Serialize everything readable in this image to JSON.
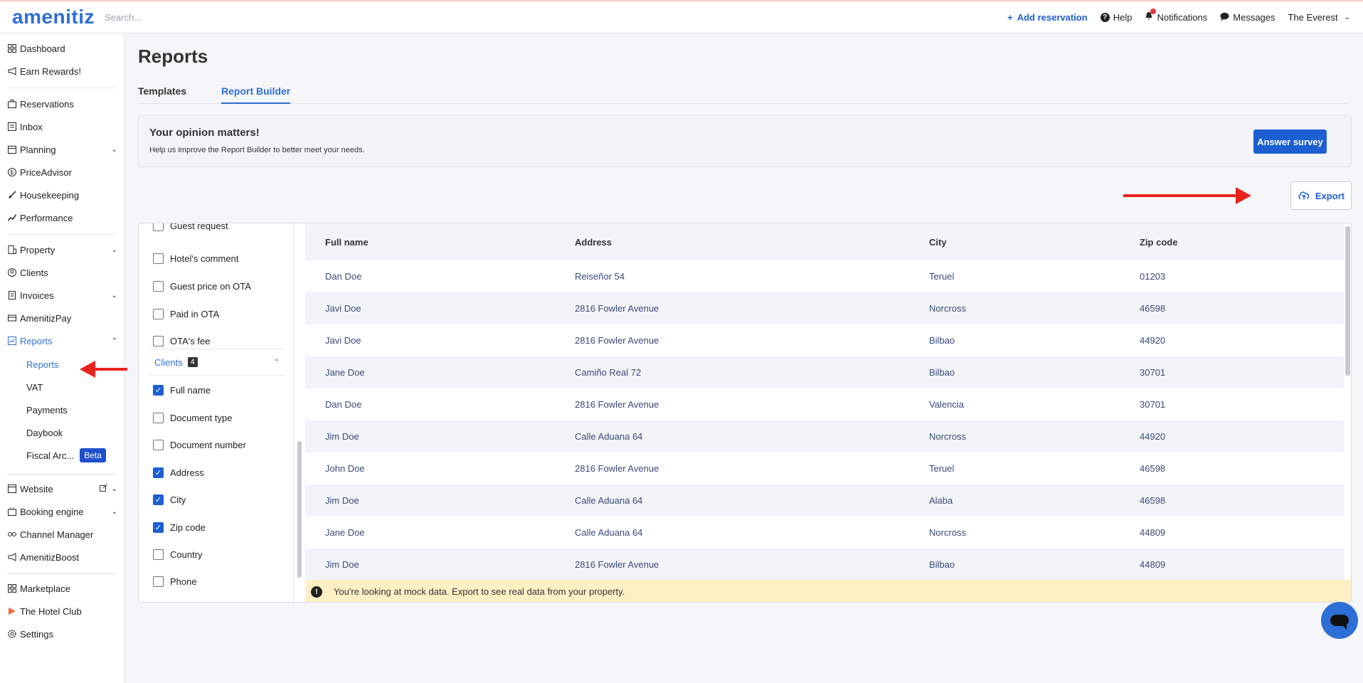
{
  "app": {
    "logo": "amenitiz",
    "search_placeholder": "Search..."
  },
  "topbar": {
    "add_reservation": "Add reservation",
    "help": "Help",
    "notifications": "Notifications",
    "messages": "Messages",
    "property_name": "The Everest"
  },
  "sidebar": {
    "items": [
      {
        "label": "Dashboard",
        "icon": "dashboard-icon"
      },
      {
        "label": "Earn Rewards!",
        "icon": "megaphone-icon"
      },
      {
        "label": "Reservations",
        "icon": "suitcase-icon"
      },
      {
        "label": "Inbox",
        "icon": "inbox-icon"
      },
      {
        "label": "Planning",
        "icon": "calendar-icon"
      },
      {
        "label": "PriceAdvisor",
        "icon": "dollar-icon"
      },
      {
        "label": "Housekeeping",
        "icon": "broom-icon"
      },
      {
        "label": "Performance",
        "icon": "trend-icon"
      },
      {
        "label": "Property",
        "icon": "building-icon"
      },
      {
        "label": "Clients",
        "icon": "clients-icon"
      },
      {
        "label": "Invoices",
        "icon": "invoice-icon"
      },
      {
        "label": "AmenitizPay",
        "icon": "card-icon"
      },
      {
        "label": "Reports",
        "icon": "chart-icon"
      },
      {
        "label": "Website",
        "icon": "website-icon"
      },
      {
        "label": "Booking engine",
        "icon": "booking-icon"
      },
      {
        "label": "Channel Manager",
        "icon": "channel-icon"
      },
      {
        "label": "AmenitizBoost",
        "icon": "boost-icon"
      },
      {
        "label": "Marketplace",
        "icon": "marketplace-icon"
      },
      {
        "label": "The Hotel Club",
        "icon": "hotelclub-icon"
      },
      {
        "label": "Settings",
        "icon": "gear-icon"
      }
    ],
    "reports_sub": [
      {
        "label": "Reports"
      },
      {
        "label": "VAT"
      },
      {
        "label": "Payments"
      },
      {
        "label": "Daybook"
      },
      {
        "label": "Fiscal Arc..."
      }
    ],
    "beta_label": "Beta"
  },
  "main": {
    "title": "Reports",
    "tabs": [
      {
        "label": "Templates"
      },
      {
        "label": "Report Builder"
      }
    ],
    "survey": {
      "title": "Your opinion matters!",
      "subtitle": "Help us improve the Report Builder to better meet your needs.",
      "button": "Answer survey"
    },
    "export_label": "Export"
  },
  "fields": {
    "top_items": [
      {
        "label": "Guest request",
        "checked": false
      },
      {
        "label": "Hotel's comment",
        "checked": false
      },
      {
        "label": "Guest price on OTA",
        "checked": false
      },
      {
        "label": "Paid in OTA",
        "checked": false
      },
      {
        "label": "OTA's fee",
        "checked": false
      }
    ],
    "group": {
      "label": "Clients",
      "count": "4"
    },
    "client_items": [
      {
        "label": "Full name",
        "checked": true
      },
      {
        "label": "Document type",
        "checked": false
      },
      {
        "label": "Document number",
        "checked": false
      },
      {
        "label": "Address",
        "checked": true
      },
      {
        "label": "City",
        "checked": true
      },
      {
        "label": "Zip code",
        "checked": true
      },
      {
        "label": "Country",
        "checked": false
      },
      {
        "label": "Phone",
        "checked": false
      }
    ]
  },
  "table": {
    "headers": [
      "Full name",
      "Address",
      "City",
      "Zip code"
    ],
    "rows": [
      [
        "Dan Doe",
        "Reiseñor 54",
        "Teruel",
        "01203"
      ],
      [
        "Javi Doe",
        "2816 Fowler Avenue",
        "Norcross",
        "46598"
      ],
      [
        "Javi Doe",
        "2816 Fowler Avenue",
        "Bilbao",
        "44920"
      ],
      [
        "Jane Doe",
        "Camiño Real 72",
        "Bilbao",
        "30701"
      ],
      [
        "Dan Doe",
        "2816 Fowler Avenue",
        "Valencia",
        "30701"
      ],
      [
        "Jim Doe",
        "Calle Aduana 64",
        "Norcross",
        "44920"
      ],
      [
        "John Doe",
        "2816 Fowler Avenue",
        "Teruel",
        "46598"
      ],
      [
        "Jim Doe",
        "Calle Aduana 64",
        "Alaba",
        "46598"
      ],
      [
        "Jane Doe",
        "Calle Aduana 64",
        "Norcross",
        "44809"
      ],
      [
        "Jim Doe",
        "2816 Fowler Avenue",
        "Bilbao",
        "44809"
      ]
    ],
    "mock_note": "You're looking at mock data. Export to see real data from your property."
  }
}
